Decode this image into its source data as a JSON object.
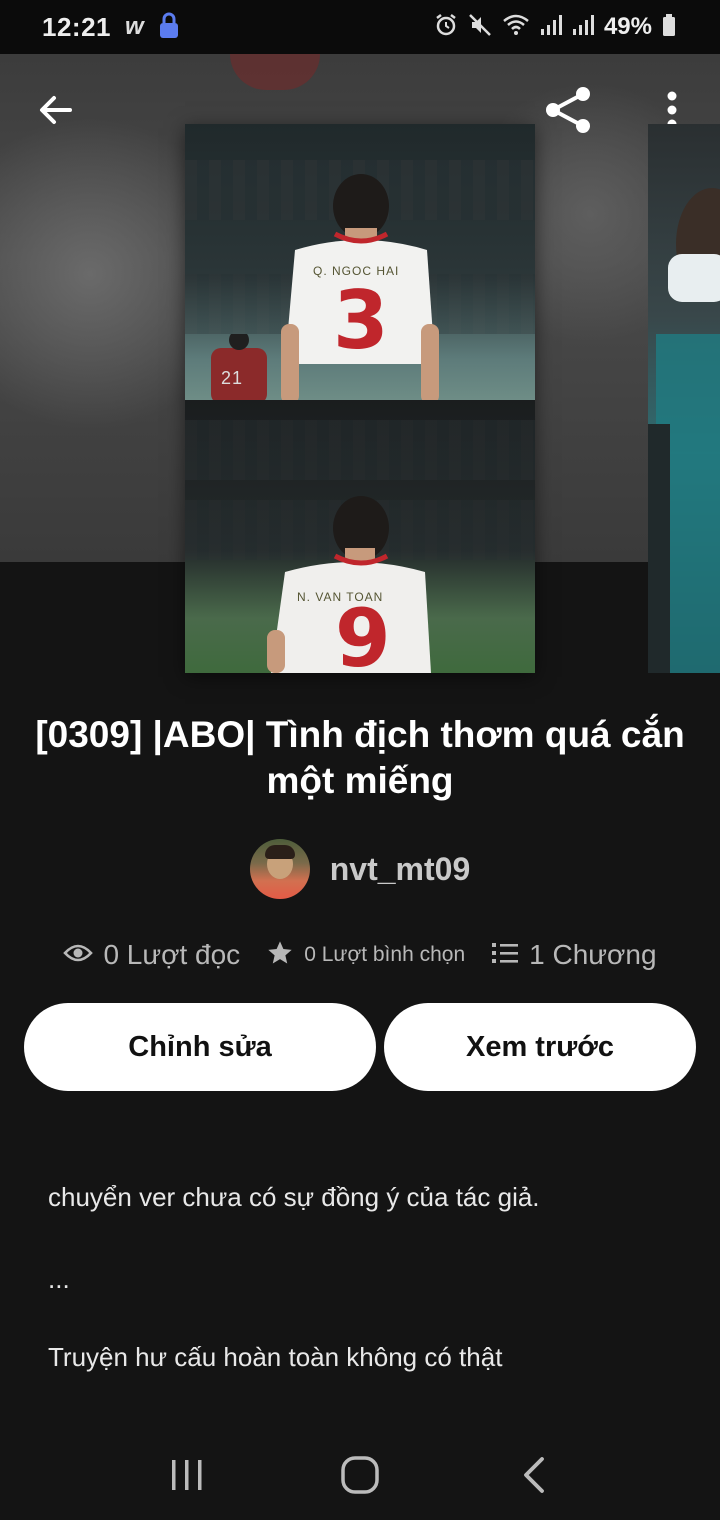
{
  "status_bar": {
    "time": "12:21",
    "app_badge": "w",
    "battery": "49%"
  },
  "story": {
    "title": "[0309] |ABO| Tình địch thơm quá cắn một miếng",
    "author": "nvt_mt09",
    "reads": "0 Lượt đọc",
    "votes": "0 Lượt bình chọn",
    "chapters": "1 Chương",
    "cover": {
      "top_jersey_name": "Q. NGOC HAI",
      "top_jersey_number": "3",
      "bottom_jersey_name": "N. VAN TOAN",
      "bottom_jersey_number": "9",
      "bg_player_number": "21"
    }
  },
  "buttons": {
    "edit": "Chỉnh sửa",
    "preview": "Xem trước"
  },
  "description": {
    "line1": "chuyển ver chưa có sự đồng ý của tác giả.",
    "line2": "...",
    "line3": "Truyện hư cấu hoàn toàn không có thật"
  },
  "icons": {
    "back": "back-arrow-icon",
    "share": "share-icon",
    "more": "more-vert-icon",
    "eye": "eye-icon",
    "star": "star-icon",
    "list": "list-icon"
  },
  "colors": {
    "background": "#141414",
    "button_bg": "#ffffff",
    "jersey_red": "#c0262c"
  }
}
